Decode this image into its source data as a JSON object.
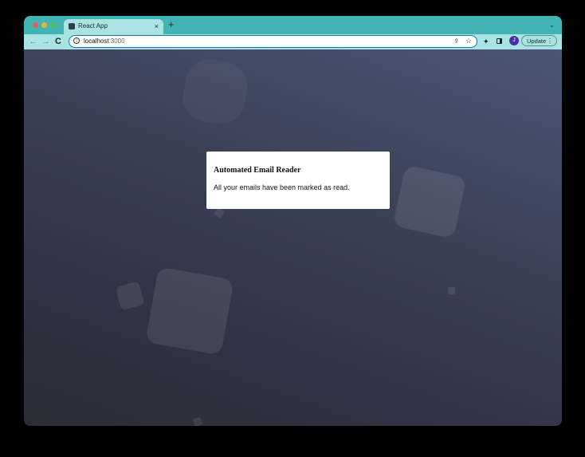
{
  "browser": {
    "tab": {
      "title": "React App",
      "close": "×"
    },
    "new_tab": "+",
    "tab_menu": "⌄",
    "nav": {
      "back": "←",
      "forward": "→",
      "reload": "C"
    },
    "omnibox": {
      "info": "i",
      "url_host": "localhost",
      "url_port": ":3000"
    },
    "icons": [
      "share-icon",
      "star-icon",
      "extensions-icon",
      "side-panel-icon"
    ],
    "avatar": "J",
    "update": {
      "label": "Update",
      "menu": "⋮"
    },
    "colors": {
      "tab_strip": "#43b4b4",
      "toolbar": "#a9e4e2",
      "avatar": "#4a2fa0"
    }
  },
  "page": {
    "card": {
      "title": "Automated Email Reader",
      "message": "All your emails have been marked as read."
    },
    "background": {
      "top": "#4b5676",
      "bottom": "#2c2d37"
    }
  }
}
